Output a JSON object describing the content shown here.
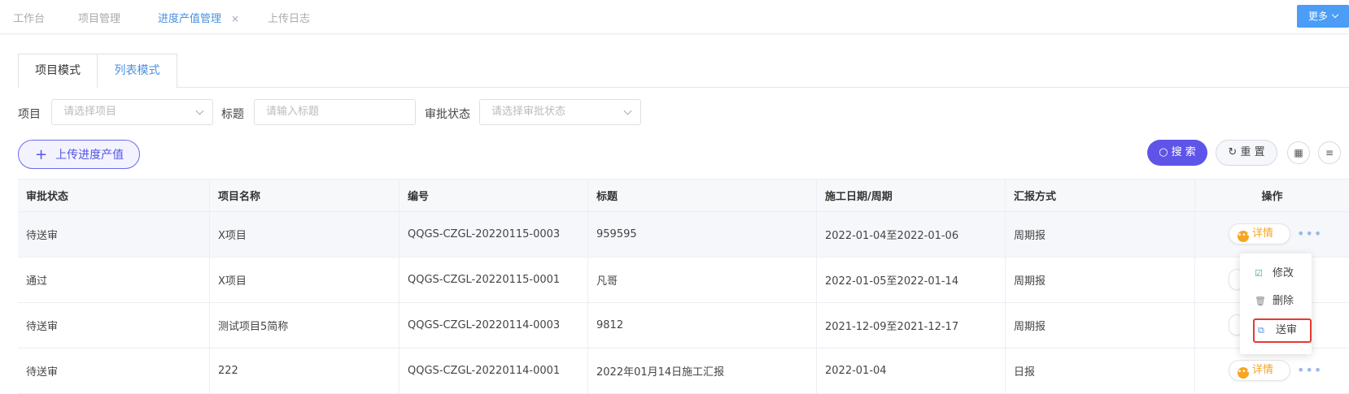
{
  "top_tabs": [
    {
      "label": "工作台",
      "active": false
    },
    {
      "label": "项目管理",
      "active": false
    },
    {
      "label": "进度产值管理",
      "active": true,
      "close": "×"
    },
    {
      "label": "上传日志",
      "active": false
    }
  ],
  "more_button": "更多",
  "mode_tabs": [
    {
      "label": "项目模式",
      "active": false
    },
    {
      "label": "列表模式",
      "active": true
    }
  ],
  "filters": {
    "project_label": "项目",
    "project_placeholder": "请选择项目",
    "title_label": "标题",
    "title_placeholder": "请输入标题",
    "status_label": "审批状态",
    "status_placeholder": "请选择审批状态"
  },
  "toolbar": {
    "upload_label": "上传进度产值",
    "search_label": "搜 索",
    "reset_label": "重 置"
  },
  "table": {
    "columns": [
      "审批状态",
      "项目名称",
      "编号",
      "标题",
      "施工日期/周期",
      "汇报方式",
      "操作"
    ],
    "rows": [
      {
        "status": "待送审",
        "project": "X项目",
        "code": "QQGS-CZGL-20220115-0003",
        "title": "959595",
        "date": "2022-01-04至2022-01-06",
        "method": "周期报"
      },
      {
        "status": "通过",
        "project": "X项目",
        "code": "QQGS-CZGL-20220115-0001",
        "title": "凡哥",
        "date": "2022-01-05至2022-01-14",
        "method": "周期报"
      },
      {
        "status": "待送审",
        "project": "测试项目5简称",
        "code": "QQGS-CZGL-20220114-0003",
        "title": "9812",
        "date": "2021-12-09至2021-12-17",
        "method": "周期报"
      },
      {
        "status": "待送审",
        "project": "222",
        "code": "QQGS-CZGL-20220114-0001",
        "title": "2022年01月14日施工汇报",
        "date": "2022-01-04",
        "method": "日报"
      }
    ],
    "detail_label": "详情"
  },
  "row_menu": {
    "edit": "修改",
    "delete": "删除",
    "submit": "送审"
  },
  "colors": {
    "accent": "#4a90e2",
    "primary_button": "#5f54e8",
    "detail": "#f5a623",
    "highlight_border": "#e53935"
  }
}
